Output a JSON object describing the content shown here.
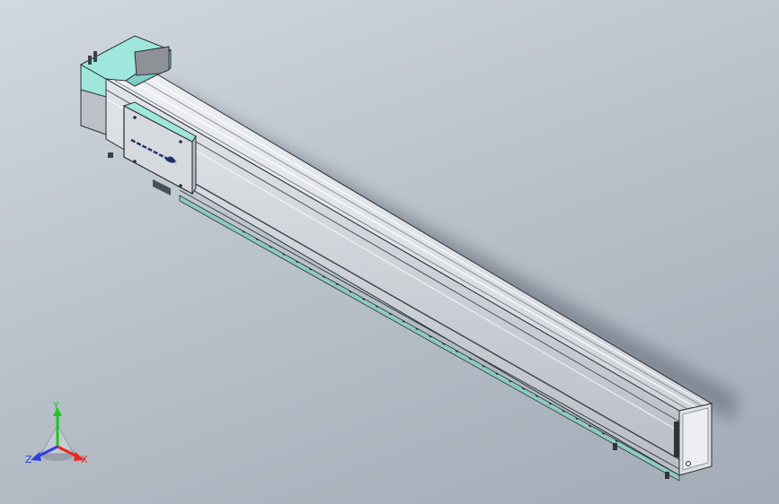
{
  "viewport": {
    "background_top": "#d2d8df",
    "background_bottom": "#a2abb6"
  },
  "model": {
    "body_color": "#c8ccd2",
    "accent_color": "#9fe6dc",
    "edge_color": "#2a2f36",
    "logo_color": "#24306a"
  },
  "triad": {
    "x_label": "X",
    "y_label": "Y",
    "z_label": "Z",
    "x_color": "#e8281e",
    "y_color": "#1fc41f",
    "z_color": "#2a3fe0"
  }
}
